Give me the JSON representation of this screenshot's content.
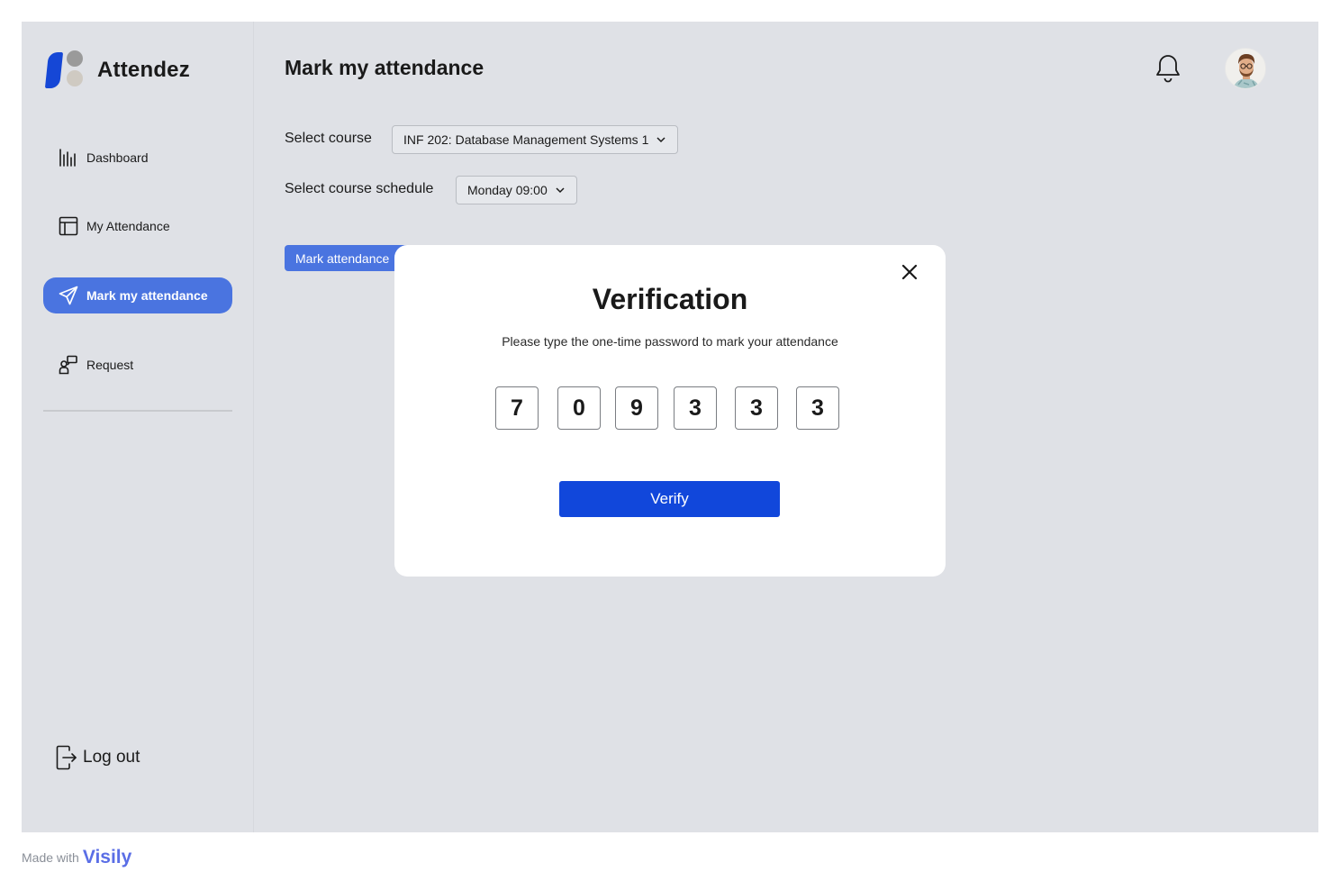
{
  "app": {
    "name": "Attendez"
  },
  "sidebar": {
    "items": [
      {
        "label": "Dashboard",
        "icon": "bar-chart-icon",
        "active": false
      },
      {
        "label": "My Attendance",
        "icon": "table-layout-icon",
        "active": false
      },
      {
        "label": "Mark my attendance",
        "icon": "send-icon",
        "active": true
      },
      {
        "label": "Request",
        "icon": "request-icon",
        "active": false
      }
    ],
    "logout_label": "Log out"
  },
  "header": {
    "title": "Mark my attendance",
    "notification_icon": "bell-icon",
    "avatar_icon": "user-avatar"
  },
  "form": {
    "course_label": "Select course",
    "course_value": "INF 202: Database Management Systems 1",
    "schedule_label": "Select course schedule",
    "schedule_value": "Monday 09:00",
    "mark_button_label": "Mark attendance"
  },
  "modal": {
    "title": "Verification",
    "subtitle": "Please type the one-time password to mark your attendance",
    "otp_digits": [
      "7",
      "0",
      "9",
      "3",
      "3",
      "3"
    ],
    "verify_label": "Verify"
  },
  "footer": {
    "made_with": "Made with",
    "brand": "Visily"
  },
  "colors": {
    "accent": "#4a74e0",
    "primary_button": "#1147db",
    "background": "#dfe1e6",
    "logo_blue": "#1547d6"
  }
}
